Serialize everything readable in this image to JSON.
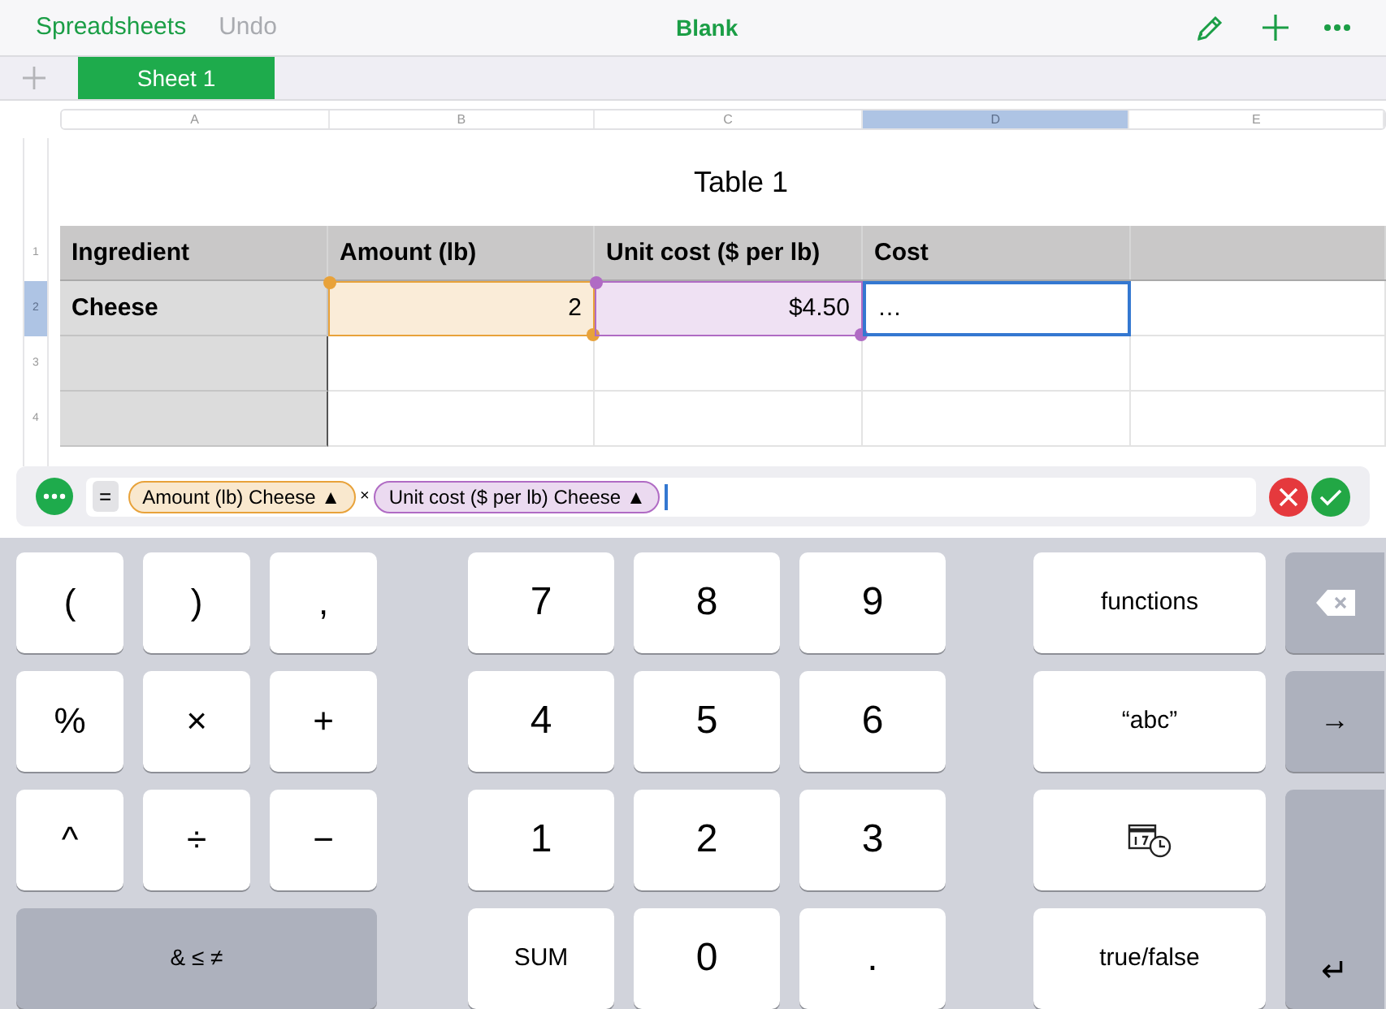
{
  "toolbar": {
    "back": "Spreadsheets",
    "undo": "Undo",
    "undo_disabled": true,
    "title": "Blank"
  },
  "sheets": [
    {
      "label": "Sheet 1",
      "selected": true
    }
  ],
  "column_headers": [
    {
      "label": "A",
      "selected": false
    },
    {
      "label": "B",
      "selected": false
    },
    {
      "label": "C",
      "selected": false
    },
    {
      "label": "D",
      "selected": true
    },
    {
      "label": "E",
      "selected": false
    }
  ],
  "table": {
    "title": "Table 1",
    "columns": [
      "Ingredient",
      "Amount (lb)",
      "Unit cost ($ per lb)",
      "Cost"
    ],
    "row_numbers": [
      {
        "label": "1",
        "selected": false
      },
      {
        "label": "2",
        "selected": true
      },
      {
        "label": "3",
        "selected": false
      },
      {
        "label": "4",
        "selected": false
      }
    ],
    "rows": [
      {
        "cells": [
          {
            "text": "Cheese",
            "kind": "label",
            "selected": false
          },
          {
            "text": "2",
            "kind": "reference",
            "color": "#e8a23a",
            "selected": false
          },
          {
            "text": "$4.50",
            "kind": "reference",
            "color": "#b06bc4",
            "selected": false
          },
          {
            "text": "…",
            "kind": "plain",
            "selected": true
          }
        ]
      }
    ]
  },
  "formula": {
    "tokens": [
      {
        "kind": "operator",
        "text": "="
      },
      {
        "kind": "reference",
        "text": "Amount (lb) Cheese ▲",
        "color": "#e8a23a"
      },
      {
        "kind": "symbol",
        "text": "×"
      },
      {
        "kind": "reference",
        "text": "Unit cost ($ per lb) Cheese ▲",
        "color": "#b06bc4"
      }
    ]
  },
  "keyboard": {
    "symbols": [
      "(",
      ")",
      ",",
      "%",
      "×",
      "+",
      "^",
      "÷",
      "−"
    ],
    "wide_key": "& ≤ ≠",
    "numbers": [
      "7",
      "8",
      "9",
      "4",
      "5",
      "6",
      "1",
      "2",
      "3",
      "SUM",
      "0",
      "."
    ],
    "functions": [
      {
        "kind": "text",
        "text": "functions"
      },
      {
        "kind": "text",
        "text": "“abc”"
      },
      {
        "kind": "date-time"
      },
      {
        "kind": "text",
        "text": "true/false"
      }
    ],
    "side": [
      {
        "kind": "backspace"
      },
      {
        "kind": "text",
        "text": "→"
      },
      {
        "kind": "return",
        "text": "↵"
      }
    ]
  }
}
